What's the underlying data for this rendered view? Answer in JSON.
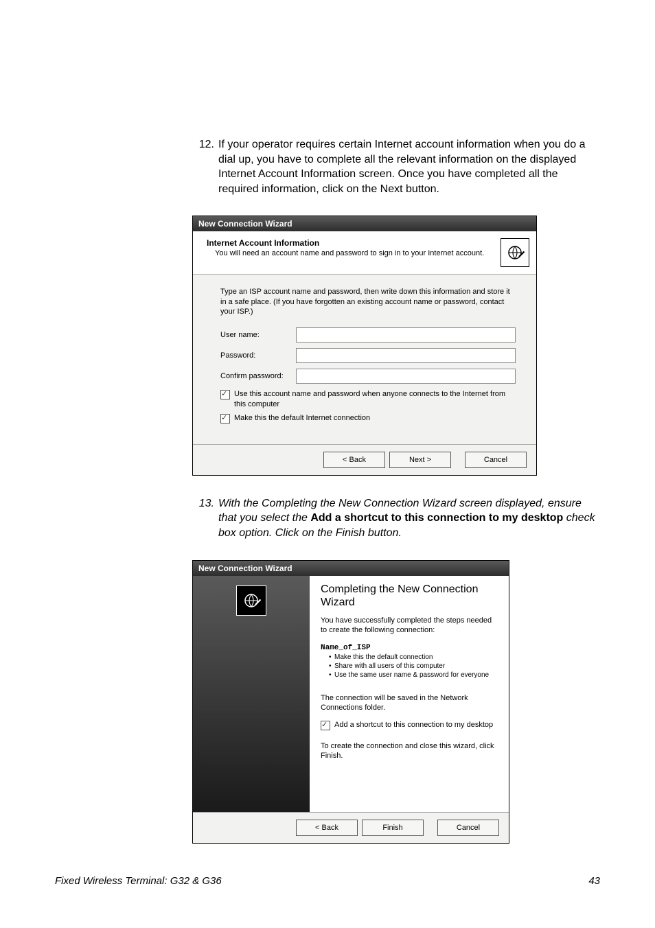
{
  "steps": {
    "s12": {
      "num": "12.",
      "text": "If your operator requires certain Internet account information when you do a dial up, you have to complete all the relevant information on the displayed Internet Account Information screen.  Once you have completed all the required information, click on the Next button."
    },
    "s13": {
      "num": "13.",
      "before": "With the Completing the New Connection Wizard screen displayed, ensure that you select the ",
      "bold": "Add a shortcut to this connection to my desktop",
      "after": " check box option.  Click on the Finish button."
    }
  },
  "wizard1": {
    "title": "New Connection Wizard",
    "header_title": "Internet Account Information",
    "header_sub": "You will need an account name and password to sign in to your Internet account.",
    "intro": "Type an ISP account name and password, then write down this information and store it in a safe place. (If you have forgotten an existing account name or password, contact your ISP.)",
    "labels": {
      "user": "User name:",
      "pass": "Password:",
      "confirm": "Confirm password:"
    },
    "check1": "Use this account  name and password when anyone connects to the Internet from this computer",
    "check2": "Make this the default Internet connection",
    "buttons": {
      "back": "< Back",
      "next": "Next >",
      "cancel": "Cancel"
    }
  },
  "wizard2": {
    "title": "New Connection Wizard",
    "heading": "Completing the New Connection Wizard",
    "success": "You have successfully completed the steps needed to create the following connection:",
    "isp_name": "Name_of_ISP",
    "bullets": [
      "Make this the default connection",
      "Share with all users of this computer",
      "Use the same user name & password for everyone"
    ],
    "saved": "The connection will be saved in the Network Connections folder.",
    "shortcut": "Add a shortcut to this connection to my desktop",
    "close": "To create the connection and close this wizard, click Finish.",
    "buttons": {
      "back": "< Back",
      "finish": "Finish",
      "cancel": "Cancel"
    }
  },
  "footer": {
    "left": "Fixed Wireless Terminal: G32 & G36",
    "page": "43"
  }
}
